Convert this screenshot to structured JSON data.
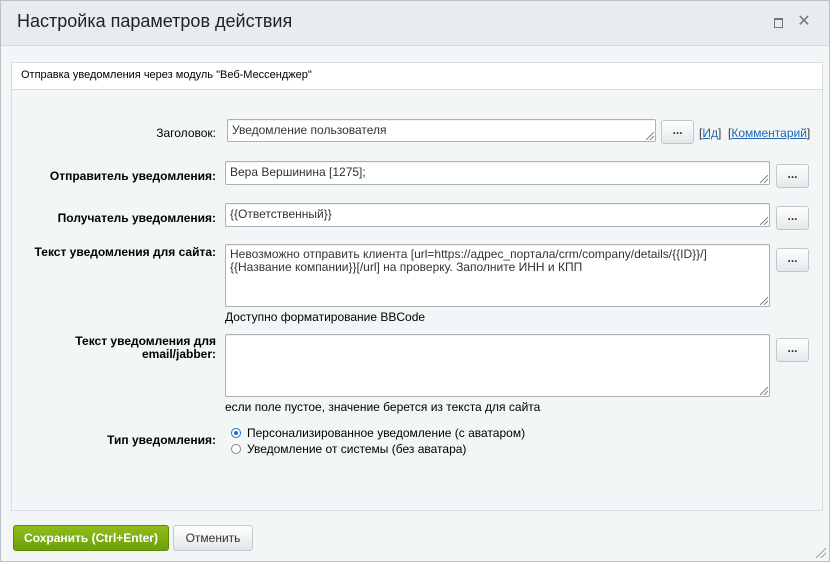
{
  "dialog": {
    "title": "Настройка параметров действия",
    "maximize_icon": "maximize-icon",
    "close_icon": "close-icon"
  },
  "panel": {
    "header": "Отправка уведомления через модуль \"Веб-Мессенджер\""
  },
  "form": {
    "title_label": "Заголовок:",
    "title_value": "Уведомление пользователя",
    "title_link_id": "Ид",
    "title_link_comment": "Комментарий",
    "sender_label": "Отправитель уведомления:",
    "sender_value": "Вера Вершинина [1275];",
    "recipient_label": "Получатель уведомления:",
    "recipient_value": "{{Ответственный}}",
    "site_text_label": "Текст уведомления для сайта:",
    "site_text_value": "Невозможно отправить клиента [url=https://адрес_портала/crm/company/details/{{ID}}/]{{Название компании}}[/url] на проверку. Заполните ИНН и КПП",
    "site_text_note": "Доступно форматирование BBCode",
    "email_text_label_line1": "Текст уведомления для",
    "email_text_label_line2": "email/jabber:",
    "email_text_value": "",
    "email_text_note": "если поле пустое, значение берется из текста для сайта",
    "type_label": "Тип уведомления:",
    "type_options": [
      {
        "label": "Персонализированное уведомление (с аватаром)",
        "checked": true
      },
      {
        "label": "Уведомление от системы (без аватара)",
        "checked": false
      }
    ],
    "dots_label": "..."
  },
  "footer": {
    "save_label": "Сохранить (Ctrl+Enter)",
    "cancel_label": "Отменить"
  },
  "colors": {
    "save_button": "#7bad12",
    "link": "#2067b0",
    "radio_checked": "#1a73c9"
  }
}
